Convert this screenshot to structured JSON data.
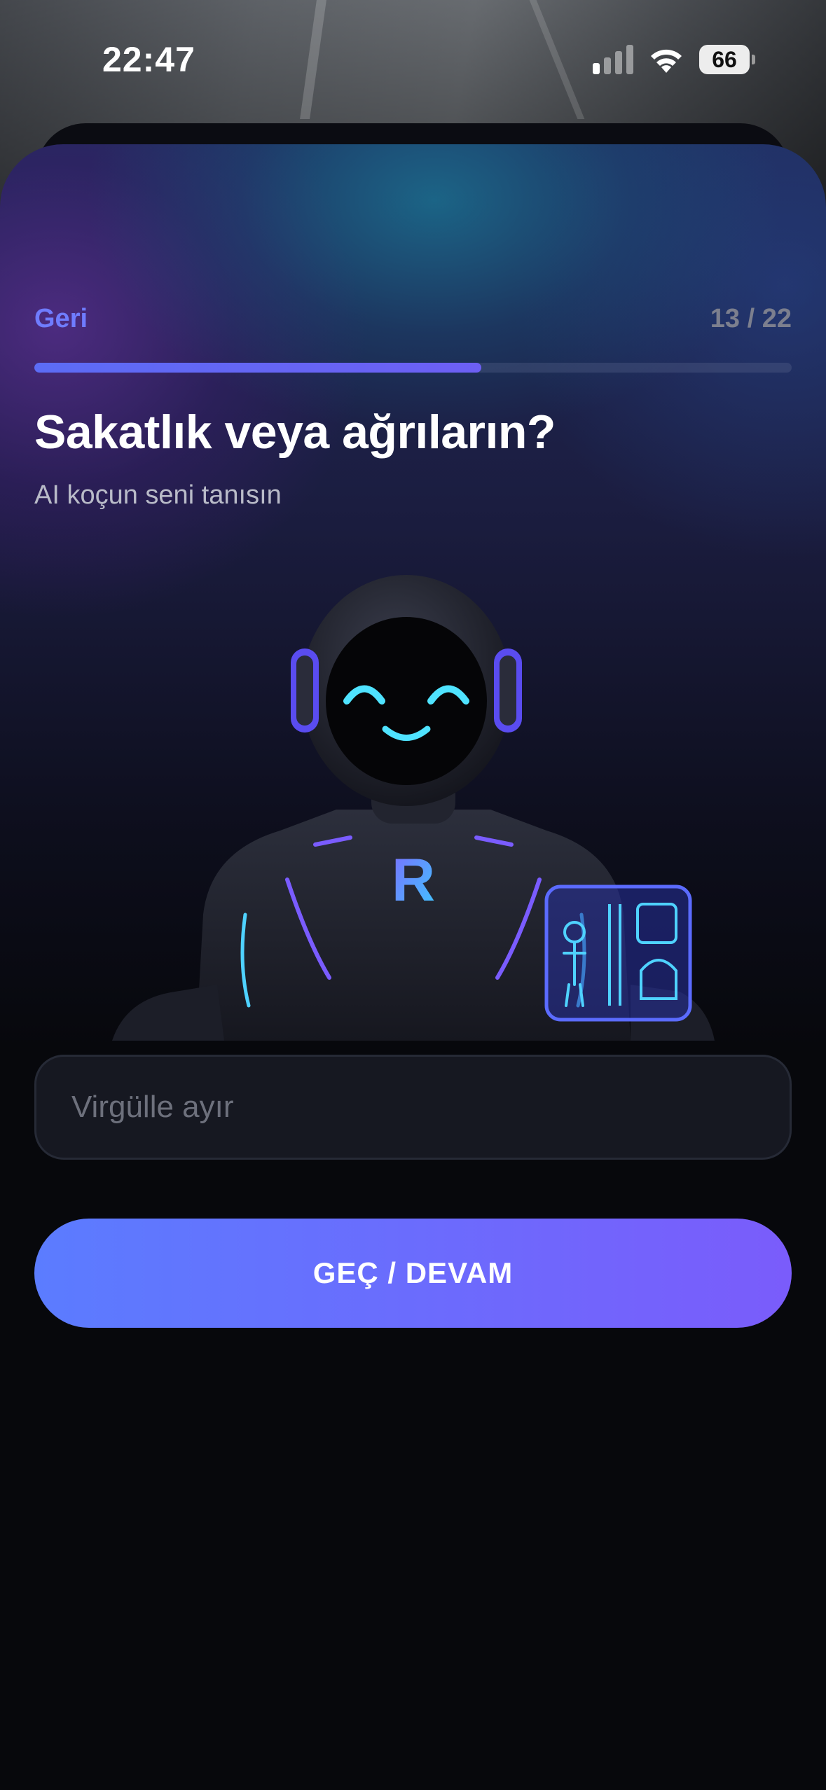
{
  "status_bar": {
    "time": "22:47",
    "battery_level": "66"
  },
  "header": {
    "back_label": "Geri",
    "progress_text": "13 / 22",
    "progress_fraction": 0.59
  },
  "question": {
    "title": "Sakatlık veya ağrıların?",
    "subtitle": "AI koçun seni tanısın"
  },
  "illustration": {
    "chest_logo": "R"
  },
  "input": {
    "value": "",
    "placeholder": "Virgülle ayır"
  },
  "cta": {
    "label": "GEÇ / DEVAM"
  },
  "colors": {
    "accent": "#6f7cff",
    "button_gradient_start": "#5b7cff",
    "button_gradient_end": "#7a5cfb",
    "background": "#07080c"
  }
}
